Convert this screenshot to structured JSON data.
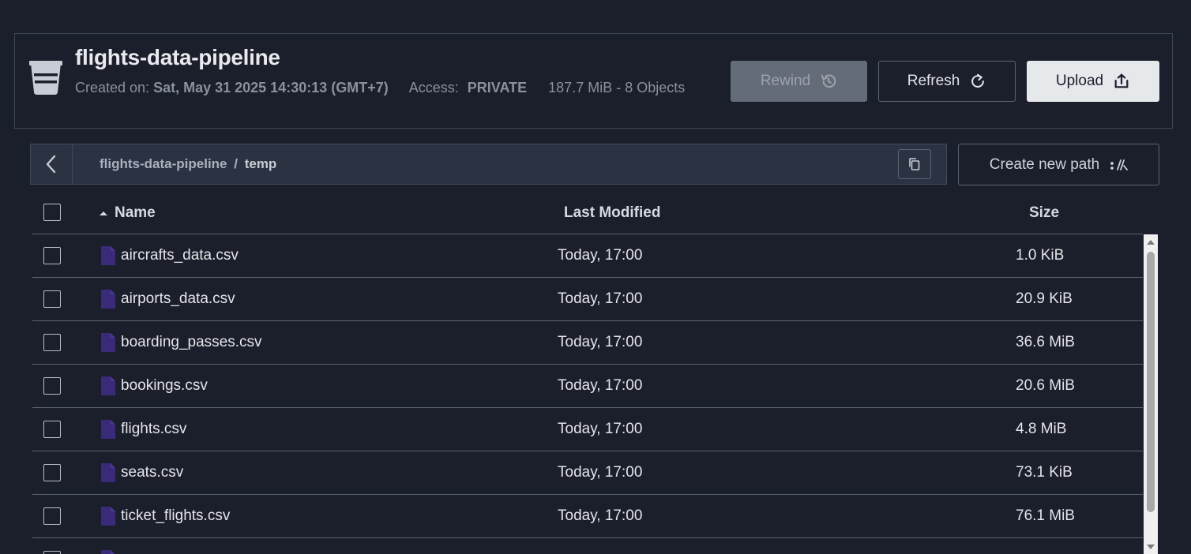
{
  "bucket": {
    "name": "flights-data-pipeline",
    "created_label": "Created on:",
    "created_value": "Sat, May 31 2025 14:30:13 (GMT+7)",
    "access_label": "Access:",
    "access_value": "PRIVATE",
    "size_summary": "187.7 MiB - 8 Objects"
  },
  "toolbar": {
    "rewind_label": "Rewind",
    "refresh_label": "Refresh",
    "upload_label": "Upload"
  },
  "path": {
    "root": "flights-data-pipeline",
    "separator": "/",
    "current": "temp",
    "create_label": "Create new path"
  },
  "table": {
    "columns": {
      "name": "Name",
      "modified": "Last Modified",
      "size": "Size"
    },
    "sort": "name-ascending",
    "rows": [
      {
        "name": "aircrafts_data.csv",
        "modified": "Today, 17:00",
        "size": "1.0 KiB"
      },
      {
        "name": "airports_data.csv",
        "modified": "Today, 17:00",
        "size": "20.9 KiB"
      },
      {
        "name": "boarding_passes.csv",
        "modified": "Today, 17:00",
        "size": "36.6 MiB"
      },
      {
        "name": "bookings.csv",
        "modified": "Today, 17:00",
        "size": "20.6 MiB"
      },
      {
        "name": "flights.csv",
        "modified": "Today, 17:00",
        "size": "4.8 MiB"
      },
      {
        "name": "seats.csv",
        "modified": "Today, 17:00",
        "size": "73.1 KiB"
      },
      {
        "name": "ticket_flights.csv",
        "modified": "Today, 17:00",
        "size": "76.1 MiB"
      }
    ]
  },
  "colors": {
    "background": "#1b1f2b",
    "file_icon": "#3a2a7a",
    "upload_bg": "#e6e9ec",
    "rewind_bg": "#646b79"
  },
  "icons": {
    "bucket": "bucket-icon",
    "rewind": "history-icon",
    "refresh": "refresh-icon",
    "upload": "upload-icon",
    "back": "chevron-left-icon",
    "copy": "copy-icon",
    "new_path": "new-path-icon",
    "file": "file-icon"
  }
}
